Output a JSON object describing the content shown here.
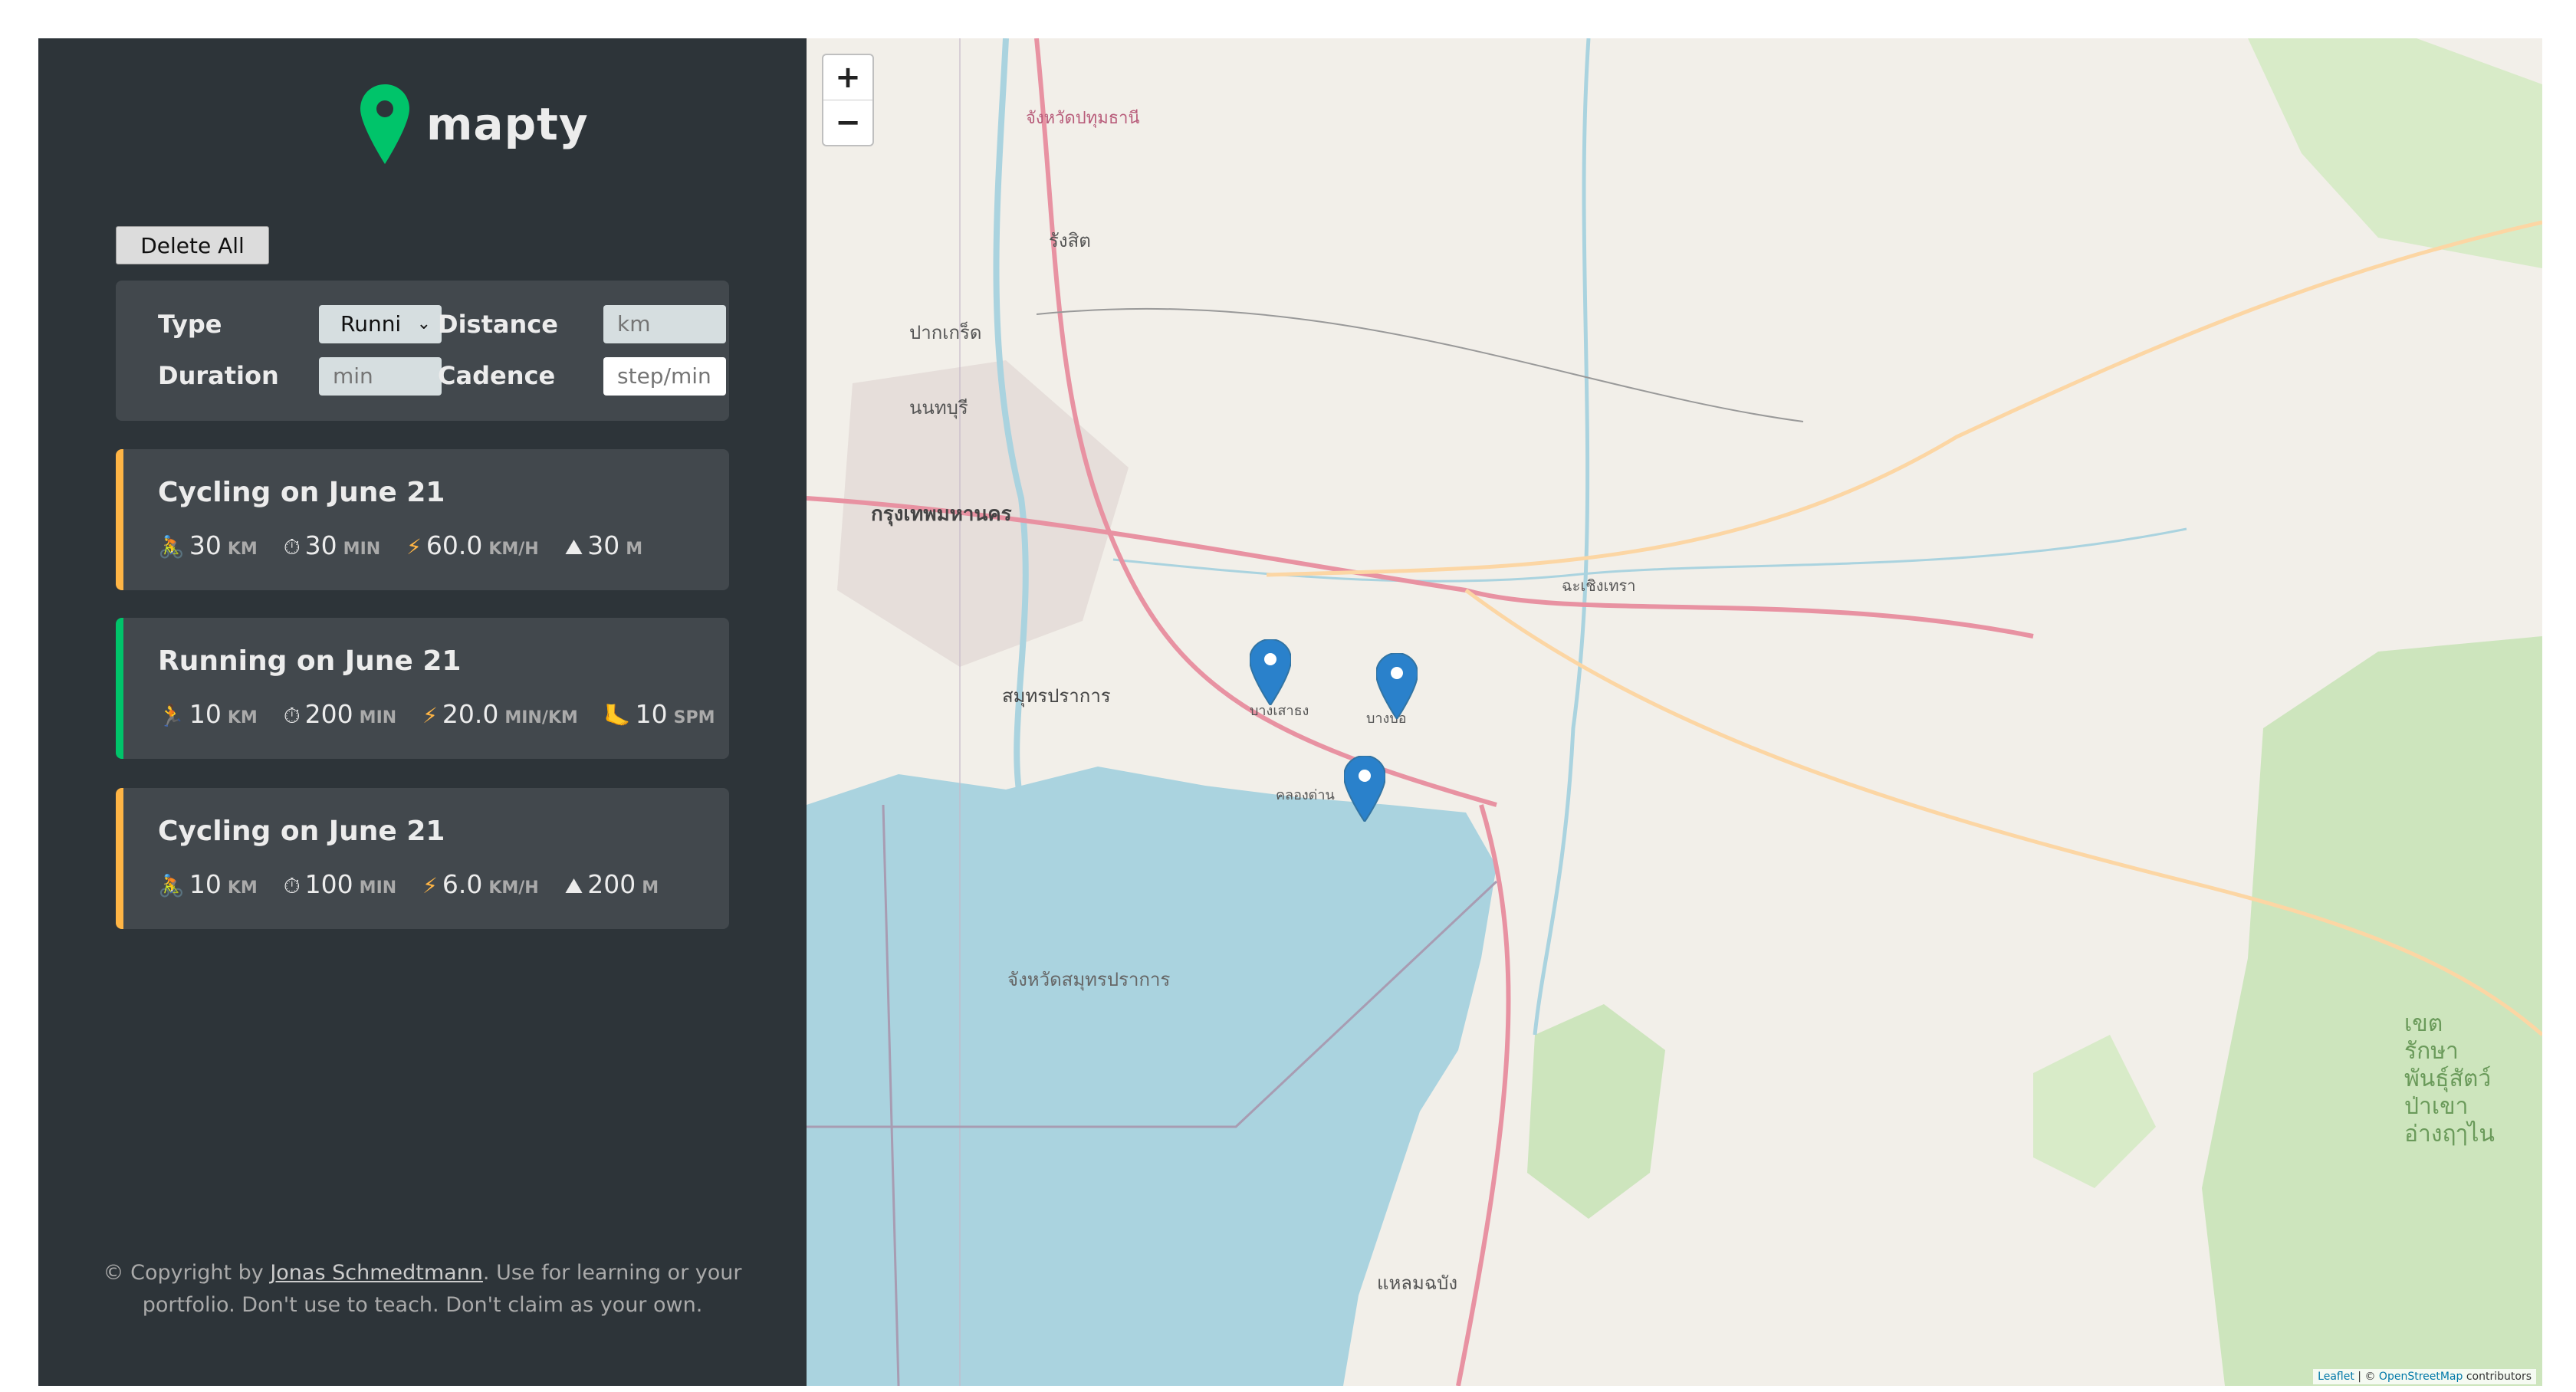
{
  "app": {
    "name": "mapty"
  },
  "colors": {
    "sidebar": "#2d3439",
    "card": "#42484d",
    "cycling": "#ffb545",
    "running": "#00c46a",
    "brand": "#00c46a",
    "map_marker": "#2a81cb"
  },
  "toolbar": {
    "delete_all_label": "Delete All"
  },
  "form": {
    "type_label": "Type",
    "type_value": "Runni",
    "distance_label": "Distance",
    "distance_placeholder": "km",
    "duration_label": "Duration",
    "duration_placeholder": "min",
    "cadence_label": "Cadence",
    "cadence_placeholder": "step/min"
  },
  "workouts": [
    {
      "type": "cycling",
      "title": "Cycling on June 21",
      "distance": "30",
      "distance_unit": "km",
      "duration": "30",
      "duration_unit": "min",
      "speed": "60.0",
      "speed_unit": "km/h",
      "extra": "30",
      "extra_unit": "m",
      "icons": [
        "cyclist-icon",
        "stopwatch-icon",
        "lightning-icon",
        "mountain-icon"
      ]
    },
    {
      "type": "running",
      "title": "Running on June 21",
      "distance": "10",
      "distance_unit": "km",
      "duration": "200",
      "duration_unit": "min",
      "speed": "20.0",
      "speed_unit": "min/km",
      "extra": "10",
      "extra_unit": "spm",
      "icons": [
        "runner-icon",
        "stopwatch-icon",
        "lightning-icon",
        "footprint-icon"
      ]
    },
    {
      "type": "cycling",
      "title": "Cycling on June 21",
      "distance": "10",
      "distance_unit": "km",
      "duration": "100",
      "duration_unit": "min",
      "speed": "6.0",
      "speed_unit": "km/h",
      "extra": "200",
      "extra_unit": "m",
      "icons": [
        "cyclist-icon",
        "stopwatch-icon",
        "lightning-icon",
        "mountain-icon"
      ]
    }
  ],
  "footer": {
    "prefix": "© Copyright by ",
    "author": "Jonas Schmedtmann",
    "suffix": ". Use for learning or your",
    "line2": "portfolio. Don't use to teach. Don't claim as your own."
  },
  "map": {
    "zoom_in": "+",
    "zoom_out": "−",
    "attribution_leaflet": "Leaflet",
    "attribution_sep": " | © ",
    "attribution_osm": "OpenStreetMap",
    "attribution_suffix": " contributors",
    "places": {
      "bangkok": "กรุงเทพมหานคร",
      "samut_prakan": "สมุทรปราการ",
      "samut_prakan_province": "จังหวัดสมุทรปราการ",
      "pathum_thani": "จังหวัดปทุมธานี",
      "rangsit": "รังสิต",
      "nonthaburi": "นนทบุรี",
      "pak_kret": "ปากเกร็ด",
      "laem_chabang": "แหลมฉบัง",
      "chachoengsao": "ฉะเชิงเทรา",
      "wildlife_sanctuary": "เขตรักษาพันธุ์สัตว์ป่าเขาอ่างฤๅไน",
      "bang_sao_thong": "บางเสาธง",
      "bang_bo": "บางบ่อ",
      "khlong_dan": "คลองด่าน"
    }
  }
}
